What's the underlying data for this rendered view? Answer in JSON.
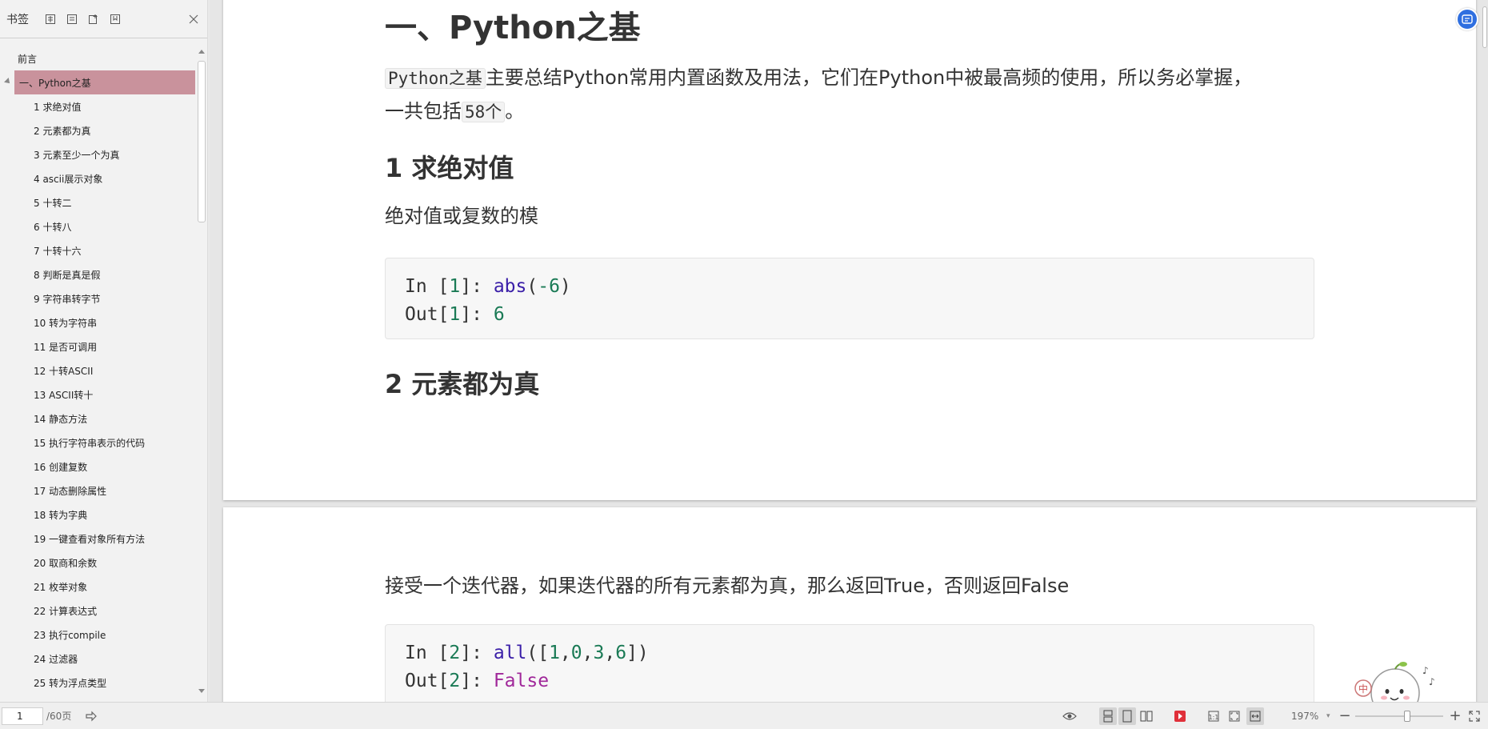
{
  "sidebar": {
    "title": "书签",
    "tools": [
      "expand-icon",
      "collapse-icon",
      "add-bookmark-icon",
      "bookmark-icon"
    ],
    "close_icon": "close-icon",
    "items": [
      {
        "label": "前言",
        "level": 0,
        "active": false
      },
      {
        "label": "一、Python之基",
        "level": 0,
        "active": true,
        "expandable": true
      },
      {
        "label": "1 求绝对值",
        "level": 1
      },
      {
        "label": "2 元素都为真",
        "level": 1
      },
      {
        "label": "3 元素至少一个为真",
        "level": 1
      },
      {
        "label": "4 ascii展示对象",
        "level": 1
      },
      {
        "label": "5  十转二",
        "level": 1
      },
      {
        "label": "6 十转八",
        "level": 1
      },
      {
        "label": "7 十转十六",
        "level": 1
      },
      {
        "label": "8 判断是真是假",
        "level": 1
      },
      {
        "label": "9  字符串转字节",
        "level": 1
      },
      {
        "label": "10 转为字符串",
        "level": 1
      },
      {
        "label": "11 是否可调用",
        "level": 1
      },
      {
        "label": "12 十转ASCII",
        "level": 1
      },
      {
        "label": "13 ASCII转十",
        "level": 1
      },
      {
        "label": "14 静态方法",
        "level": 1
      },
      {
        "label": "15 执行字符串表示的代码",
        "level": 1
      },
      {
        "label": "16  创建复数",
        "level": 1
      },
      {
        "label": "17 动态删除属性",
        "level": 1
      },
      {
        "label": "18 转为字典",
        "level": 1
      },
      {
        "label": "19 一键查看对象所有方法",
        "level": 1
      },
      {
        "label": "20 取商和余数",
        "level": 1
      },
      {
        "label": "21 枚举对象",
        "level": 1
      },
      {
        "label": "22 计算表达式",
        "level": 1
      },
      {
        "label": "23 执行compile",
        "level": 1
      },
      {
        "label": "24 过滤器",
        "level": 1
      },
      {
        "label": "25 转为浮点类型",
        "level": 1
      }
    ]
  },
  "document": {
    "page1": {
      "heading": "一、Python之基",
      "intro_code1": "Python之基",
      "intro_text1": "主要总结Python常用内置函数及用法，它们在Python中被最高频的使用，所以务必掌握，",
      "intro_text2": "一共包括",
      "intro_code2": "58个",
      "intro_text3": "。",
      "section1_title": "1 求绝对值",
      "section1_desc": "绝对值或复数的模",
      "code1": {
        "in_prefix": "In ",
        "in_open": "[",
        "in_num": "1",
        "in_close": "]: ",
        "fn": "abs",
        "paren_open": "(",
        "arg": "-6",
        "paren_close": ")",
        "out_prefix": "Out",
        "out_open": "[",
        "out_num": "1",
        "out_close": "]: ",
        "out_value": "6"
      },
      "section2_title": "2 元素都为真"
    },
    "page2": {
      "desc": "接受一个迭代器，如果迭代器的所有元素都为真，那么返回True，否则返回False",
      "code2": {
        "in_prefix": "In ",
        "in_open": "[",
        "in_num": "2",
        "in_close": "]: ",
        "fn": "all",
        "args_open": "([",
        "a1": "1",
        "c1": ",",
        "a2": "0",
        "c2": ",",
        "a3": "3",
        "c3": ",",
        "a4": "6",
        "args_close": "])",
        "out_prefix": "Out",
        "out_open": "[",
        "out_num": "2",
        "out_close": "]: ",
        "out_value": "False"
      }
    }
  },
  "statusbar": {
    "page_value": "1",
    "page_total": "/60页",
    "zoom": "197%",
    "zoom_fraction": 0.55,
    "minus": "−",
    "plus": "+"
  },
  "colors": {
    "active_bookmark": "#c9929c",
    "code_number": "#1a7a55",
    "code_function": "#3a1ea8",
    "code_false": "#a0289a",
    "play_red": "#e0303a",
    "badge_blue": "#2f6fe0"
  }
}
